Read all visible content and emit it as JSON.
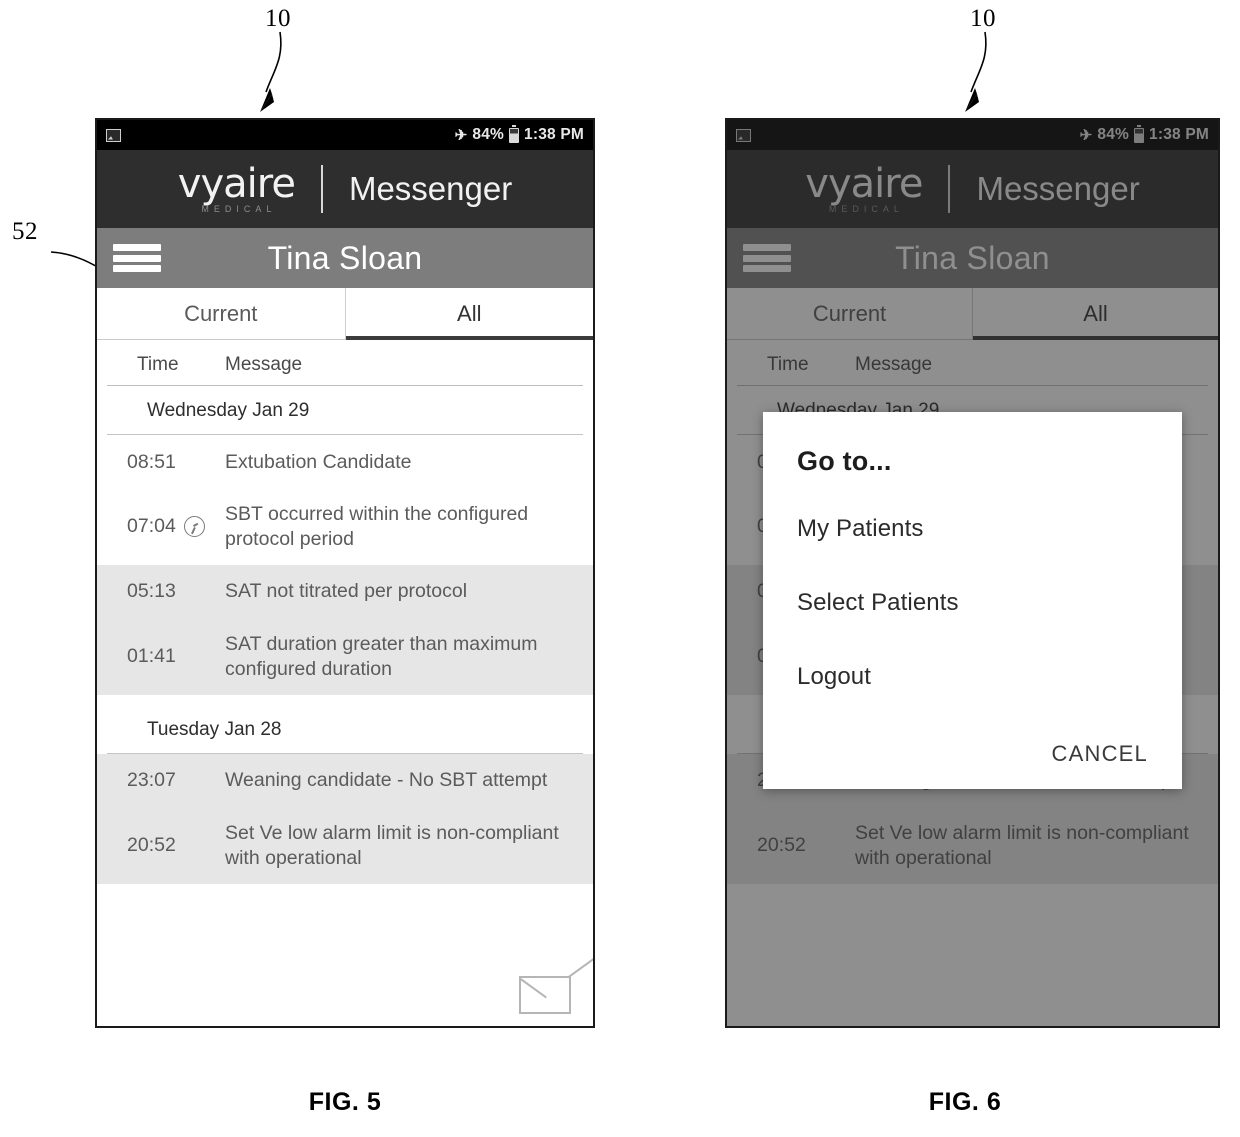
{
  "sheet": {
    "figures": [
      {
        "caption": "FIG. 5",
        "ref_numeral": "10"
      },
      {
        "caption": "FIG. 6",
        "ref_numeral": "10"
      }
    ],
    "menu_ref_numeral": "52"
  },
  "status_bar": {
    "image_icon": "photo-icon",
    "airplane_icon": "airplane-mode-icon",
    "battery_percent": "84%",
    "battery_icon": "battery-icon",
    "time": "1:38 PM"
  },
  "brand": {
    "logo_word": "vyaire",
    "logo_sub": "MEDICAL",
    "app_name": "Messenger"
  },
  "title_bar": {
    "menu_icon": "hamburger-menu-icon",
    "patient_name": "Tina Sloan"
  },
  "tabs": [
    {
      "label": "Current",
      "active": false
    },
    {
      "label": "All",
      "active": true
    }
  ],
  "columns": {
    "time": "Time",
    "message": "Message"
  },
  "groups": [
    {
      "day": "Wednesday Jan 29",
      "rows": [
        {
          "time": "08:51",
          "text": "Extubation Candidate",
          "shaded": false,
          "icon": null
        },
        {
          "time": "07:04",
          "text": "SBT occurred within the configured protocol period",
          "shaded": false,
          "icon": "clock-icon"
        },
        {
          "time": "05:13",
          "text": "SAT not titrated per protocol",
          "shaded": true,
          "icon": null
        },
        {
          "time": "01:41",
          "text": "SAT duration greater than maximum configured duration",
          "shaded": true,
          "icon": null
        }
      ]
    },
    {
      "day": "Tuesday Jan 28",
      "rows": [
        {
          "time": "23:07",
          "text": "Weaning candidate - No SBT attempt",
          "shaded": true,
          "icon": null
        },
        {
          "time": "20:52",
          "text": "Set Ve low alarm limit is non-compliant with operational",
          "shaded": true,
          "icon": null
        }
      ]
    }
  ],
  "compose": {
    "icon": "envelope-icon"
  },
  "dialog": {
    "title": "Go to...",
    "items": [
      {
        "label": "My Patients"
      },
      {
        "label": "Select Patients"
      },
      {
        "label": "Logout"
      }
    ],
    "cancel_label": "CANCEL"
  },
  "colors": {
    "status_bar_bg": "#000000",
    "brand_bar_bg": "#2e2e2e",
    "title_bar_bg": "#7d7d7d",
    "row_shade": "#e6e6e6",
    "tab_indicator": "#3c3c3c"
  }
}
